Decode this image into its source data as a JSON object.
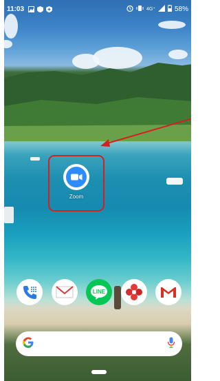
{
  "status_bar": {
    "time": "11:03",
    "network_label": "4G⁺",
    "battery": "58%",
    "left_icons": [
      "image-icon",
      "shield-icon",
      "shield-plus-icon"
    ],
    "right_icons": [
      "alarm-icon",
      "vibrate-icon",
      "signal-icon",
      "battery-icon"
    ]
  },
  "home_apps": [
    {
      "label": "Zoom",
      "icon": "zoom-video-icon",
      "color": "#2d8cff"
    }
  ],
  "dock": [
    {
      "name": "phone",
      "icon": "phone-icon"
    },
    {
      "name": "mail",
      "icon": "mail-icon"
    },
    {
      "name": "line",
      "icon": "line-icon",
      "text": "LINE"
    },
    {
      "name": "photos",
      "icon": "flower-icon"
    },
    {
      "name": "gmail",
      "icon": "gmail-icon"
    }
  ],
  "search_bar": {
    "logo": "google-g-icon",
    "mic": "mic-icon",
    "placeholder": ""
  },
  "annotations": {
    "highlight_color": "#d32020",
    "arrow_color": "#d32020"
  }
}
